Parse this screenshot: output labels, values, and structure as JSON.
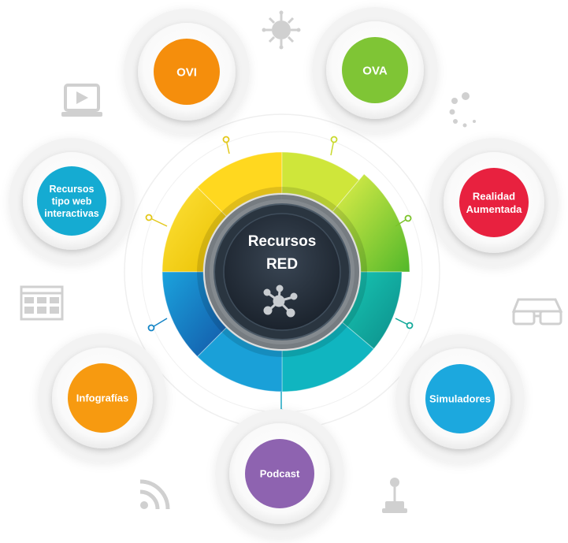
{
  "center": {
    "line1": "Recursos",
    "line2": "RED",
    "icon": "network-hub-icon"
  },
  "nodes": [
    {
      "id": "ovi",
      "lines": [
        "OVI"
      ],
      "color": "#f58e0c"
    },
    {
      "id": "ova",
      "lines": [
        "OVA"
      ],
      "color": "#7fc535"
    },
    {
      "id": "realidad",
      "lines": [
        "Realidad",
        "Aumentada"
      ],
      "color": "#e8213f"
    },
    {
      "id": "simuladores",
      "lines": [
        "Simuladores"
      ],
      "color": "#1ca8de"
    },
    {
      "id": "podcast",
      "lines": [
        "Podcast"
      ],
      "color": "#8e63b0"
    },
    {
      "id": "infografias",
      "lines": [
        "Infografías"
      ],
      "color": "#f79a10"
    },
    {
      "id": "recursos-web",
      "lines": [
        "Recursos",
        "tipo web",
        "interactivas"
      ],
      "color": "#15abd2"
    }
  ],
  "decorative_icons": [
    "virus-icon",
    "video-player-icon",
    "loading-spinner-icon",
    "web-layout-icon",
    "3d-glasses-icon",
    "rss-icon",
    "joystick-icon"
  ]
}
